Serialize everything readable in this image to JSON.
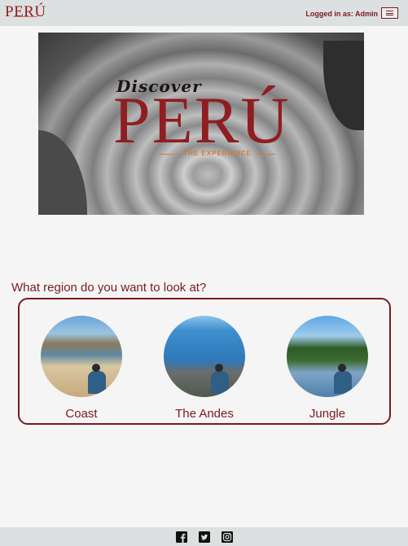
{
  "header": {
    "logo_text": "PERÚ",
    "login_status": "Logged in as: Admin",
    "menu_icon": "hamburger-icon"
  },
  "hero": {
    "discover_text": "Discover",
    "title": "PERÚ",
    "subtitle": "THE EXPERIENCE"
  },
  "regions": {
    "question": "What region do you want to look at?",
    "items": [
      {
        "label": "Coast"
      },
      {
        "label": "The Andes"
      },
      {
        "label": "Jungle"
      }
    ]
  },
  "footer": {
    "icons": [
      "facebook-icon",
      "twitter-icon",
      "instagram-icon"
    ]
  },
  "colors": {
    "accent": "#7a1a1f",
    "bar_background": "#dde0e0",
    "page_background": "#f5f5f5"
  }
}
